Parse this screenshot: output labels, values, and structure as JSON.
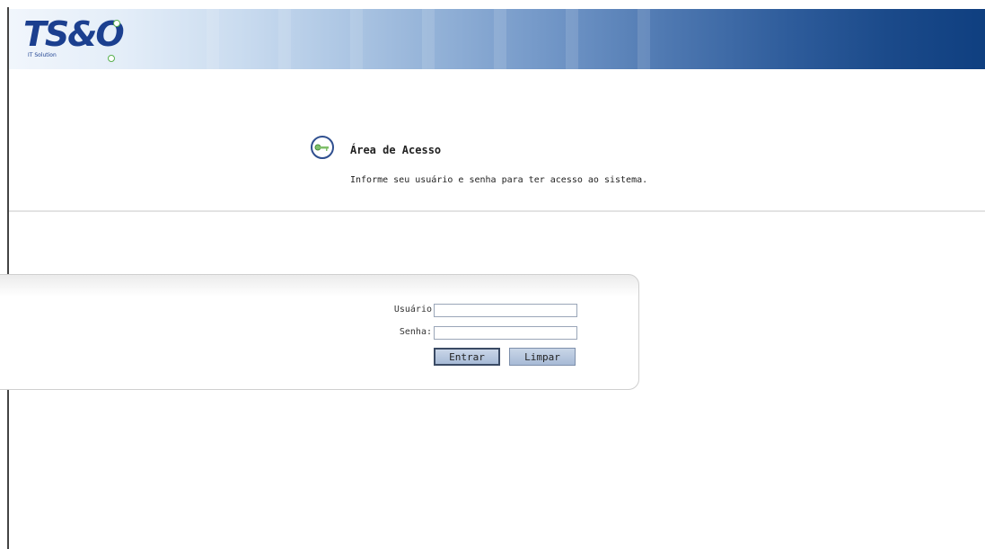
{
  "banner": {
    "logo_text": "TS&O",
    "logo_subtitle": "IT Solution",
    "colors": {
      "left": "#f1f6fc",
      "right": "#0f3f80",
      "logo": "#1b3f8f",
      "logo_accent": "#58b04e"
    }
  },
  "access": {
    "icon": "key-icon",
    "title": "Área de Acesso",
    "subtitle": "Informe seu usuário e senha para ter acesso ao sistema."
  },
  "login": {
    "username_label": "Usuário",
    "username_value": "",
    "password_label": "Senha:",
    "password_value": "",
    "submit_label": "Entrar",
    "clear_label": "Limpar"
  }
}
